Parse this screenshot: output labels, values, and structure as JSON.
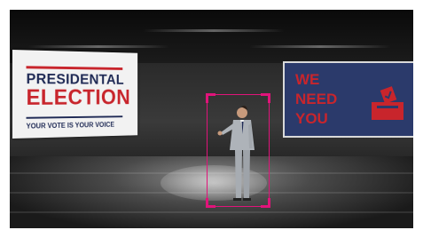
{
  "left_panel": {
    "title_line1": "PRESIDENTAL",
    "title_line2": "ELECTION",
    "tagline": "YOUR VOTE IS YOUR VOICE"
  },
  "right_panel": {
    "lines": [
      "WE",
      "NEED",
      "YOU"
    ],
    "icon": "ballot-box-icon"
  },
  "colors": {
    "navy": "#1f2a55",
    "red": "#c8252c",
    "panel_blue": "#2b3a6b",
    "selection": "#e0147a"
  }
}
